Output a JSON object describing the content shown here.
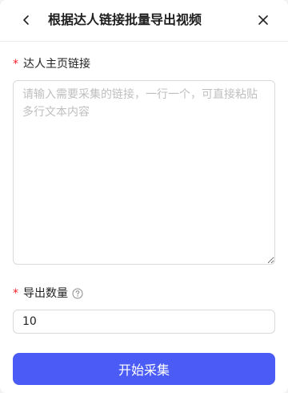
{
  "header": {
    "title": "根据达人链接批量导出视频",
    "back_icon": "chevron-left-icon",
    "close_icon": "close-icon"
  },
  "form": {
    "links": {
      "required_mark": "*",
      "label": "达人主页链接",
      "value": "",
      "placeholder": "请输入需要采集的链接，一行一个，可直接粘贴多行文本内容"
    },
    "count": {
      "required_mark": "*",
      "label": "导出数量",
      "help_icon": "question-circle-icon",
      "value": "10"
    }
  },
  "actions": {
    "start_label": "开始采集"
  },
  "colors": {
    "primary": "#4a5cf5",
    "required": "#f5222d"
  }
}
